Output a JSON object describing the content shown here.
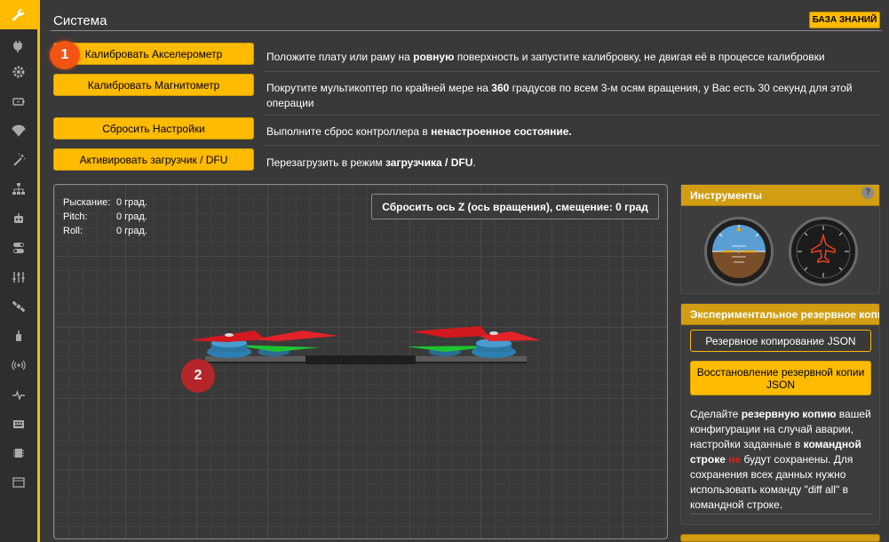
{
  "sidebar": {
    "items": [
      {
        "icon": "wrench-icon",
        "active": true
      },
      {
        "icon": "plug-icon"
      },
      {
        "icon": "gear-icon"
      },
      {
        "icon": "battery-icon"
      },
      {
        "icon": "parachute-icon"
      },
      {
        "icon": "magic-wand-icon"
      },
      {
        "icon": "network-icon"
      },
      {
        "icon": "robot-icon"
      },
      {
        "icon": "toggles-icon"
      },
      {
        "icon": "sliders-icon"
      },
      {
        "icon": "satellite-icon"
      },
      {
        "icon": "motor-icon"
      },
      {
        "icon": "radio-icon"
      },
      {
        "icon": "pulse-icon"
      },
      {
        "icon": "osd-icon"
      },
      {
        "icon": "chip-icon"
      },
      {
        "icon": "terminal-icon"
      }
    ]
  },
  "header": {
    "title": "Система",
    "wiki_label": "БАЗА ЗНАНИЙ"
  },
  "actions": {
    "calibrate_acc": {
      "label": "Калибровать Акселерометр",
      "desc_a": "Положите плату или раму на ",
      "desc_b": "ровную",
      "desc_c": " поверхность и запустите калибровку, не двигая её в процессе калибровки"
    },
    "calibrate_mag": {
      "label": "Калибровать Магнитометр",
      "desc_a": "Покрутите мультикоптер по крайней мере на ",
      "desc_b": "360",
      "desc_c": " градусов по всем 3-м осям вращения, у Вас есть 30 секунд для этой операции"
    },
    "reset_settings": {
      "label": "Сбросить Настройки",
      "desc_a": "Выполните сброс контроллера в ",
      "desc_b": "ненастроенное состояние."
    },
    "bootloader": {
      "label": "Активировать загрузчик / DFU",
      "desc_a": "Перезагрузить в режим ",
      "desc_b": "загрузчика / DFU",
      "desc_c": "."
    }
  },
  "badges": {
    "step1": "1",
    "step2": "2"
  },
  "model_view": {
    "yaw_label": "Рыскание:",
    "yaw_value": "0 град.",
    "pitch_label": "Pitch:",
    "pitch_value": "0 град.",
    "roll_label": "Roll:",
    "roll_value": "0 град.",
    "reset_z_label": "Сбросить ось Z (ось вращения), смещение: 0 град"
  },
  "instruments": {
    "title": "Инструменты",
    "help": "?"
  },
  "backup": {
    "title": "Экспериментальное резервное копирование и восстановление",
    "backup_label": "Резервное копирование JSON",
    "restore_label": "Восстановление резервной копии JSON",
    "text_1": "Сделайте ",
    "text_2": "резервную копию",
    "text_3": " вашей конфигурации на случай аварии, настройки заданные в ",
    "text_4": "командной строке",
    "text_5": " ",
    "text_6": "не",
    "text_7": " будут сохранены. Для сохранения всех данных нужно использовать команду \"diff all\" в командной строке."
  },
  "colors": {
    "accent": "#ffbb00",
    "rail": "#2e2e2e",
    "panel_head": "#d29d12",
    "badge_orange": "#f25412",
    "badge_red": "#b5262b"
  }
}
